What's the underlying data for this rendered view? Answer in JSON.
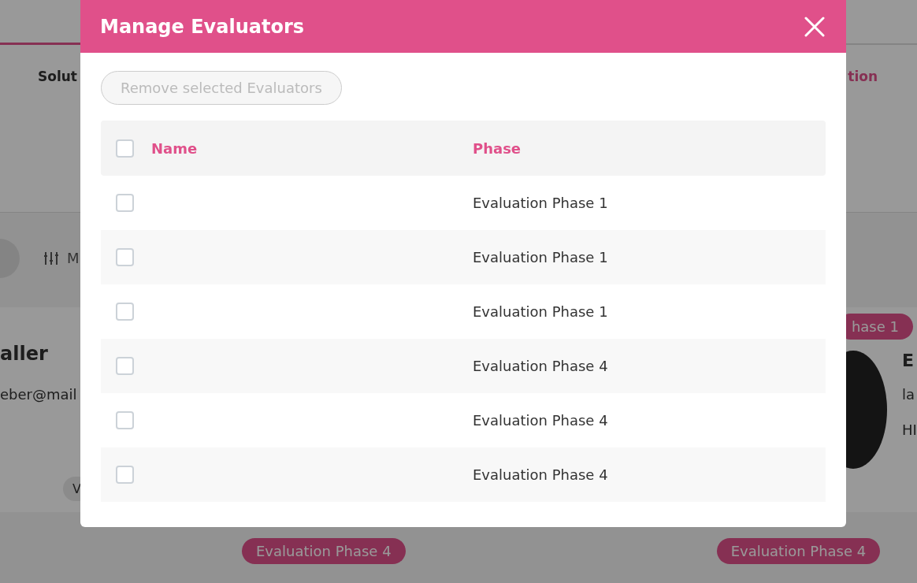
{
  "background": {
    "tabs": [
      {
        "label": "Solut",
        "selected": false
      },
      {
        "label": "tion",
        "selected": true
      }
    ],
    "filter_label": "M",
    "left_card": {
      "name": "aller",
      "email": "eber@mail",
      "button": "V"
    },
    "right_card": {
      "badge": "hase 1",
      "name": "E",
      "line_1": "la",
      "line_2": "HI"
    },
    "bottom_badges": [
      "Evaluation Phase 4",
      "Evaluation Phase 4"
    ]
  },
  "dialog": {
    "title": "Manage Evaluators",
    "remove_button": {
      "label": "Remove selected Evaluators",
      "disabled": true
    },
    "columns": [
      "Name",
      "Phase"
    ],
    "select_all_checked": false,
    "rows": [
      {
        "checked": false,
        "phase": "Evaluation Phase 1"
      },
      {
        "checked": false,
        "phase": "Evaluation Phase 1"
      },
      {
        "checked": false,
        "phase": "Evaluation Phase 1"
      },
      {
        "checked": false,
        "phase": "Evaluation Phase 4"
      },
      {
        "checked": false,
        "phase": "Evaluation Phase 4"
      },
      {
        "checked": false,
        "phase": "Evaluation Phase 4"
      }
    ]
  }
}
